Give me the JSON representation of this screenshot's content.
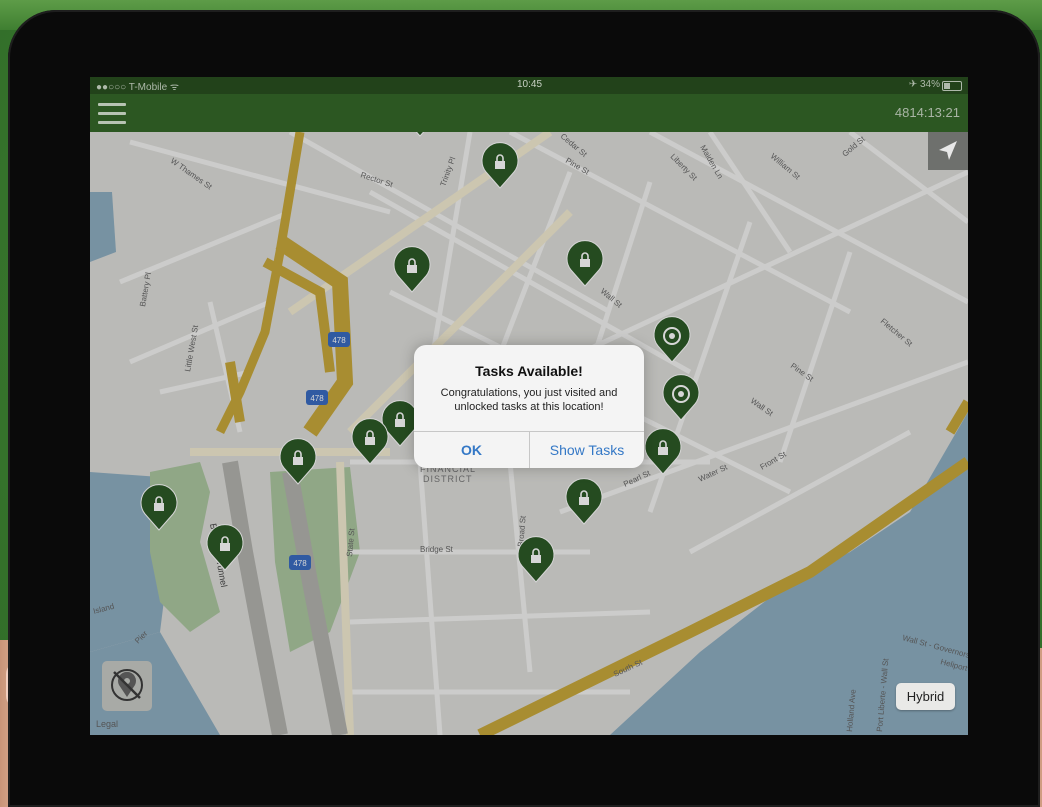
{
  "status_bar": {
    "carrier": "●●○○○ T-Mobile ᯤ",
    "time": "10:45",
    "battery": "✈ 34%"
  },
  "nav": {
    "timer": "4814:13:21"
  },
  "dialog": {
    "title": "Tasks Available!",
    "message_line1": "Congratulations, you just visited and",
    "message_line2": "unlocked tasks at this location!",
    "ok_label": "OK",
    "show_tasks_label": "Show Tasks"
  },
  "map": {
    "street_labels": [
      "Rector St",
      "Trinity Pl",
      "Wall St",
      "Pine St",
      "Liberty St",
      "Cedar St",
      "Maiden Ln",
      "William St",
      "Gold St",
      "Water St",
      "Pearl St",
      "Front St",
      "Fletcher St",
      "Pine St",
      "Wall St",
      "South St",
      "Bridge St",
      "State St",
      "Battery Pl",
      "Little West St",
      "W Thames St",
      "Broad St",
      "Wall St - Governors",
      "Heliport",
      "Holland Ave",
      "Port Liberte - Wall St"
    ],
    "district_line1": "FINANCIAL",
    "district_line2": "DISTRICT",
    "tunnel_label": "Brooklyn Tunnel",
    "highway_shield": "478",
    "highway_shield_2": "478",
    "highway_shield_3": "478",
    "island_label": "Island",
    "ferry_label": "Pier"
  },
  "hybrid_label": "Hybrid",
  "legal_label": "Legal",
  "colors": {
    "nav_bg": "#2c5722",
    "marker": "#2d5a27",
    "dialog_button": "#3478c6",
    "highway": "#c9a83b",
    "water": "#7fa1b6",
    "park": "#a6c19b"
  }
}
